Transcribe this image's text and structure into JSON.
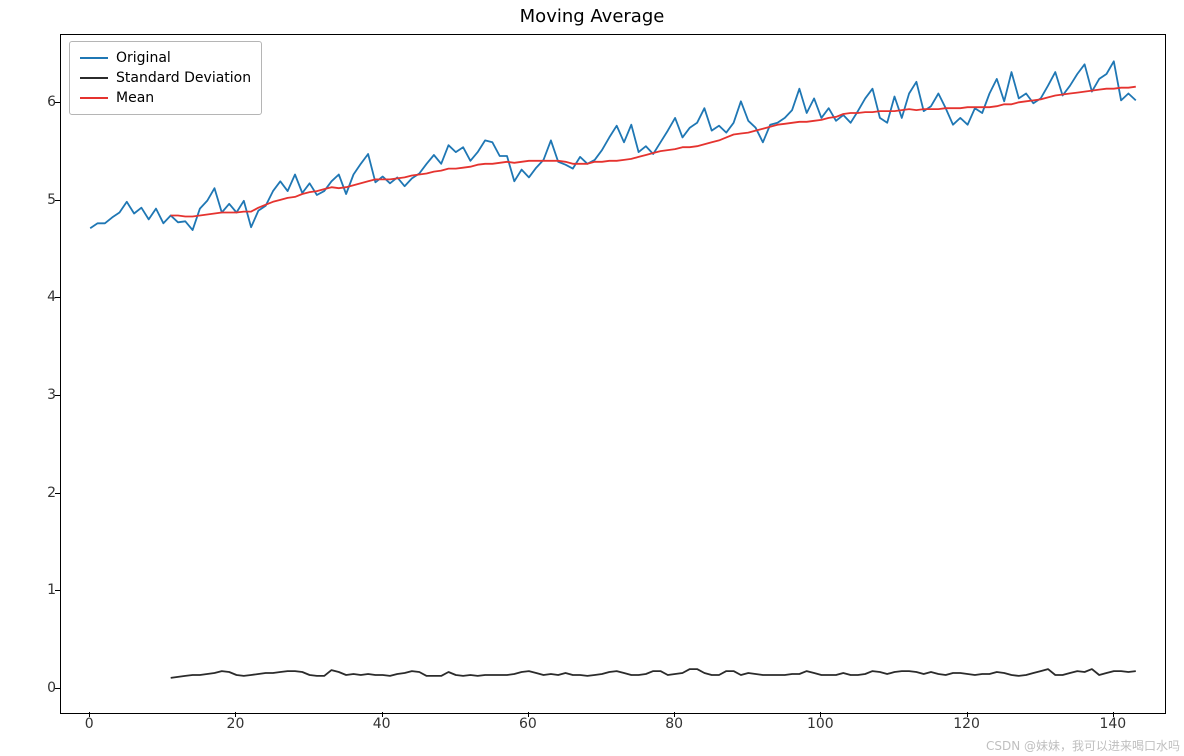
{
  "chart_data": {
    "type": "line",
    "title": "Moving Average",
    "xlabel": "",
    "ylabel": "",
    "xlim": [
      -4,
      147
    ],
    "ylim": [
      -0.25,
      6.7
    ],
    "xticks": [
      0,
      20,
      40,
      60,
      80,
      100,
      120,
      140
    ],
    "yticks": [
      0,
      1,
      2,
      3,
      4,
      5,
      6
    ],
    "series": [
      {
        "name": "Original",
        "color": "#1f77b4",
        "x_start": 0,
        "values": [
          4.72,
          4.77,
          4.77,
          4.83,
          4.88,
          4.99,
          4.87,
          4.93,
          4.81,
          4.92,
          4.77,
          4.85,
          4.78,
          4.79,
          4.7,
          4.92,
          5.0,
          5.13,
          4.88,
          4.97,
          4.88,
          5.0,
          4.73,
          4.9,
          4.95,
          5.1,
          5.2,
          5.1,
          5.27,
          5.08,
          5.18,
          5.06,
          5.1,
          5.2,
          5.27,
          5.07,
          5.27,
          5.38,
          5.48,
          5.19,
          5.25,
          5.18,
          5.24,
          5.15,
          5.23,
          5.28,
          5.38,
          5.47,
          5.38,
          5.57,
          5.5,
          5.55,
          5.41,
          5.5,
          5.62,
          5.6,
          5.46,
          5.46,
          5.2,
          5.32,
          5.24,
          5.34,
          5.42,
          5.62,
          5.4,
          5.37,
          5.33,
          5.45,
          5.38,
          5.42,
          5.52,
          5.65,
          5.77,
          5.6,
          5.78,
          5.5,
          5.56,
          5.48,
          5.6,
          5.72,
          5.85,
          5.65,
          5.75,
          5.8,
          5.95,
          5.72,
          5.77,
          5.7,
          5.8,
          6.02,
          5.82,
          5.75,
          5.6,
          5.78,
          5.8,
          5.85,
          5.93,
          6.15,
          5.9,
          6.05,
          5.85,
          5.95,
          5.82,
          5.88,
          5.8,
          5.92,
          6.05,
          6.15,
          5.85,
          5.8,
          6.07,
          5.85,
          6.1,
          6.22,
          5.92,
          5.97,
          6.1,
          5.95,
          5.78,
          5.85,
          5.78,
          5.95,
          5.9,
          6.1,
          6.25,
          6.02,
          6.32,
          6.05,
          6.1,
          6.0,
          6.05,
          6.18,
          6.32,
          6.08,
          6.18,
          6.3,
          6.4,
          6.12,
          6.25,
          6.3,
          6.43,
          6.03,
          6.1,
          6.03
        ]
      },
      {
        "name": "Standard Deviation",
        "color": "#2b2b2b",
        "x_start": 11,
        "values": [
          0.11,
          0.12,
          0.13,
          0.14,
          0.14,
          0.15,
          0.16,
          0.18,
          0.17,
          0.14,
          0.13,
          0.14,
          0.15,
          0.16,
          0.16,
          0.17,
          0.18,
          0.18,
          0.17,
          0.14,
          0.13,
          0.13,
          0.19,
          0.17,
          0.14,
          0.15,
          0.14,
          0.15,
          0.14,
          0.14,
          0.13,
          0.15,
          0.16,
          0.18,
          0.17,
          0.13,
          0.13,
          0.13,
          0.17,
          0.14,
          0.13,
          0.14,
          0.13,
          0.14,
          0.14,
          0.14,
          0.14,
          0.15,
          0.17,
          0.18,
          0.16,
          0.14,
          0.15,
          0.14,
          0.16,
          0.14,
          0.14,
          0.13,
          0.14,
          0.15,
          0.17,
          0.18,
          0.16,
          0.14,
          0.14,
          0.15,
          0.18,
          0.18,
          0.14,
          0.15,
          0.16,
          0.2,
          0.2,
          0.16,
          0.14,
          0.14,
          0.18,
          0.18,
          0.14,
          0.16,
          0.15,
          0.14,
          0.14,
          0.14,
          0.14,
          0.15,
          0.15,
          0.18,
          0.16,
          0.14,
          0.14,
          0.14,
          0.16,
          0.14,
          0.14,
          0.15,
          0.18,
          0.17,
          0.15,
          0.17,
          0.18,
          0.18,
          0.17,
          0.15,
          0.17,
          0.15,
          0.14,
          0.16,
          0.16,
          0.15,
          0.14,
          0.15,
          0.15,
          0.17,
          0.16,
          0.14,
          0.13,
          0.14,
          0.16,
          0.18,
          0.2,
          0.14,
          0.14,
          0.16,
          0.18,
          0.17,
          0.2,
          0.14,
          0.16,
          0.18,
          0.18,
          0.17,
          0.18
        ]
      },
      {
        "name": "Mean",
        "color": "#e5332f",
        "x_start": 11,
        "values": [
          4.85,
          4.85,
          4.84,
          4.84,
          4.85,
          4.86,
          4.87,
          4.88,
          4.88,
          4.88,
          4.89,
          4.89,
          4.93,
          4.96,
          4.99,
          5.01,
          5.03,
          5.04,
          5.07,
          5.09,
          5.1,
          5.12,
          5.14,
          5.13,
          5.14,
          5.16,
          5.18,
          5.2,
          5.22,
          5.22,
          5.22,
          5.23,
          5.24,
          5.26,
          5.27,
          5.28,
          5.3,
          5.31,
          5.33,
          5.33,
          5.34,
          5.35,
          5.37,
          5.38,
          5.38,
          5.39,
          5.4,
          5.39,
          5.4,
          5.41,
          5.41,
          5.41,
          5.41,
          5.41,
          5.4,
          5.38,
          5.38,
          5.38,
          5.4,
          5.4,
          5.41,
          5.41,
          5.42,
          5.43,
          5.45,
          5.47,
          5.49,
          5.51,
          5.52,
          5.53,
          5.55,
          5.55,
          5.56,
          5.58,
          5.6,
          5.62,
          5.65,
          5.68,
          5.69,
          5.7,
          5.72,
          5.74,
          5.76,
          5.78,
          5.79,
          5.8,
          5.81,
          5.81,
          5.82,
          5.83,
          5.85,
          5.86,
          5.89,
          5.9,
          5.9,
          5.91,
          5.91,
          5.92,
          5.92,
          5.92,
          5.93,
          5.94,
          5.93,
          5.94,
          5.94,
          5.94,
          5.95,
          5.95,
          5.95,
          5.96,
          5.96,
          5.96,
          5.96,
          5.97,
          5.99,
          5.99,
          6.01,
          6.02,
          6.03,
          6.04,
          6.06,
          6.08,
          6.09,
          6.1,
          6.11,
          6.12,
          6.13,
          6.14,
          6.15,
          6.15,
          6.16,
          6.16,
          6.17
        ]
      }
    ]
  },
  "legend": {
    "items": [
      {
        "label": "Original",
        "color": "#1f77b4"
      },
      {
        "label": "Standard Deviation",
        "color": "#2b2b2b"
      },
      {
        "label": "Mean",
        "color": "#e5332f"
      }
    ]
  },
  "watermark": "CSDN @妹妹，我可以进来喝口水吗"
}
